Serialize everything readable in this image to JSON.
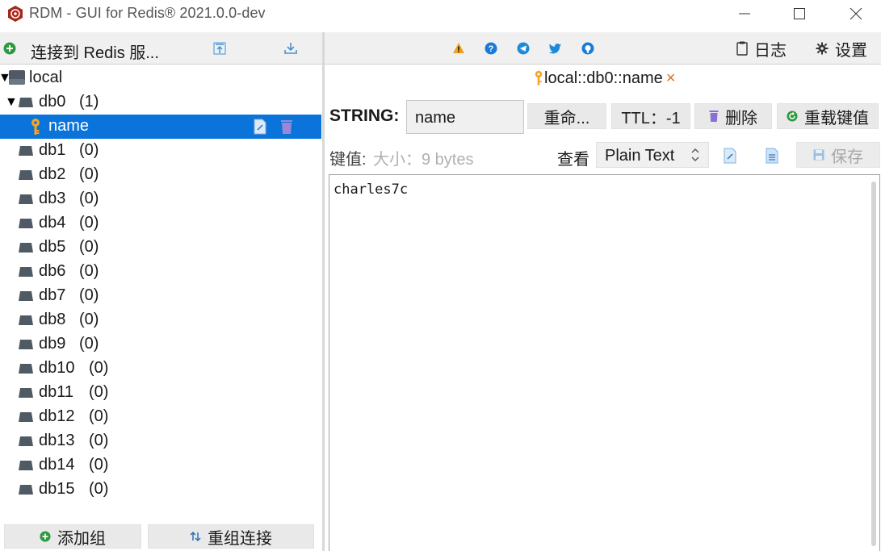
{
  "window": {
    "title": "RDM - GUI for Redis® 2021.0.0-dev"
  },
  "left_toolbar": {
    "connect_label": "连接到 Redis 服...",
    "import_icon": "import-config-icon",
    "export_icon": "export-config-icon"
  },
  "tree": {
    "connection": "local",
    "databases": [
      {
        "name": "db0",
        "count": "(1)",
        "expanded": true
      },
      {
        "name": "db1",
        "count": "(0)"
      },
      {
        "name": "db2",
        "count": "(0)"
      },
      {
        "name": "db3",
        "count": "(0)"
      },
      {
        "name": "db4",
        "count": "(0)"
      },
      {
        "name": "db5",
        "count": "(0)"
      },
      {
        "name": "db6",
        "count": "(0)"
      },
      {
        "name": "db7",
        "count": "(0)"
      },
      {
        "name": "db8",
        "count": "(0)"
      },
      {
        "name": "db9",
        "count": "(0)"
      },
      {
        "name": "db10",
        "count": "(0)"
      },
      {
        "name": "db11",
        "count": "(0)"
      },
      {
        "name": "db12",
        "count": "(0)"
      },
      {
        "name": "db13",
        "count": "(0)"
      },
      {
        "name": "db14",
        "count": "(0)"
      },
      {
        "name": "db15",
        "count": "(0)"
      }
    ],
    "selected_key": "name"
  },
  "left_bottom": {
    "add_group": "添加组",
    "reorder_connections": "重组连接"
  },
  "right_toolbar": {
    "log_label": "日志",
    "settings_label": "设置"
  },
  "tab": {
    "label": "local::db0::name"
  },
  "key_editor": {
    "type_label": "STRING:",
    "key_name": "name",
    "rename_label": "重命...",
    "ttl_label": "TTL：-1",
    "delete_label": "删除",
    "reload_label": "重载键值"
  },
  "value_row": {
    "value_label": "键值:",
    "size_label": "大小：9 bytes",
    "view_label": "查看",
    "format": "Plain Text",
    "save_label": "保存"
  },
  "editor": {
    "content": "charles7c"
  },
  "colors": {
    "selection": "#0a74da",
    "accent_orange": "#e0701c",
    "db_icon": "#505a64"
  }
}
